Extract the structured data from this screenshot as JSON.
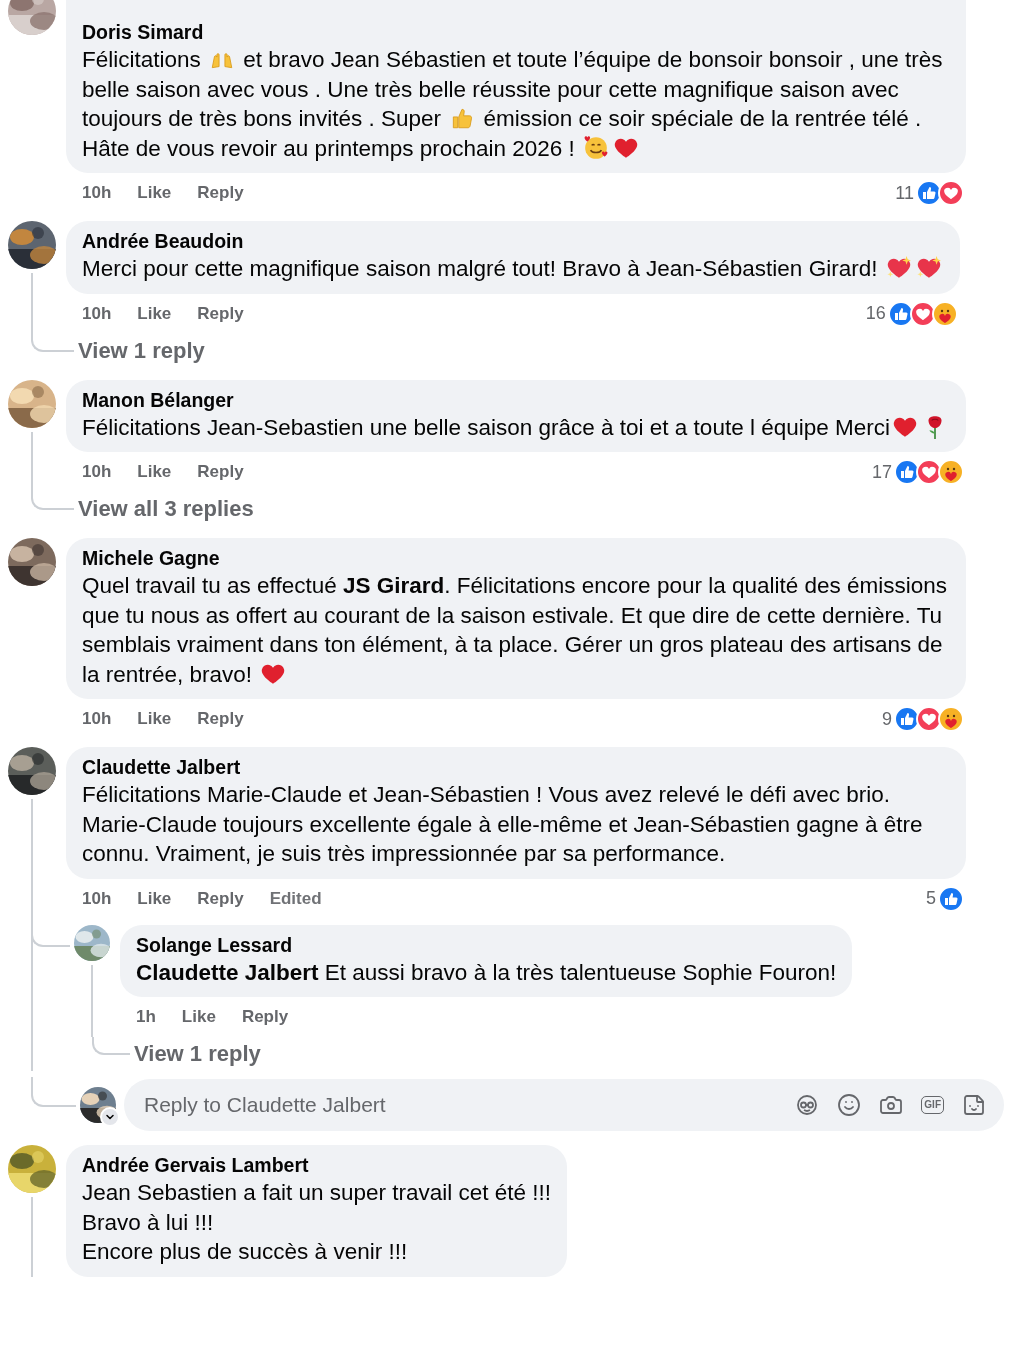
{
  "comments": [
    {
      "author": "Doris Simard",
      "body": [
        {
          "kind": "text",
          "text": "Félicitations "
        },
        {
          "kind": "clap"
        },
        {
          "kind": "text",
          "text": " et bravo Jean Sébastien et toute l’équipe de bonsoir bonsoir , une très belle saison avec vous . Une très belle réussite pour cette magnifique saison avec toujours de très bons invités . Super "
        },
        {
          "kind": "thumb"
        },
        {
          "kind": "text",
          "text": " émission ce soir spéciale de la rentrée télé . Hâte de vous revoir au printemps prochain 2026 ! "
        },
        {
          "kind": "adore"
        },
        {
          "kind": "heart"
        }
      ],
      "time": "10h",
      "actions": [
        {
          "kind": "link",
          "label": "Like"
        },
        {
          "kind": "link",
          "label": "Reply"
        }
      ],
      "reaction_count": "11",
      "reactions": [
        {
          "kind": "like"
        },
        {
          "kind": "love"
        }
      ]
    },
    {
      "author": "Andrée Beaudoin",
      "body": [
        {
          "kind": "text",
          "text": "Merci pour cette magnifique saison malgré tout! Bravo à Jean-Sébastien Girard! "
        },
        {
          "kind": "sparkle"
        },
        {
          "kind": "sparkle"
        }
      ],
      "time": "10h",
      "actions": [
        {
          "kind": "link",
          "label": "Like"
        },
        {
          "kind": "link",
          "label": "Reply"
        }
      ],
      "reaction_count": "16",
      "reactions": [
        {
          "kind": "like"
        },
        {
          "kind": "love"
        },
        {
          "kind": "care"
        }
      ],
      "replies_link": "View 1 reply"
    },
    {
      "author": "Manon Bélanger",
      "body": [
        {
          "kind": "text",
          "text": "Félicitations Jean-Sebastien une belle saison grâce à toi et a toute l équipe Merci"
        },
        {
          "kind": "heart"
        },
        {
          "kind": "rose"
        }
      ],
      "time": "10h",
      "actions": [
        {
          "kind": "link",
          "label": "Like"
        },
        {
          "kind": "link",
          "label": "Reply"
        }
      ],
      "reaction_count": "17",
      "reactions": [
        {
          "kind": "like"
        },
        {
          "kind": "love"
        },
        {
          "kind": "care"
        }
      ],
      "replies_link": "View all 3 replies"
    },
    {
      "author": "Michele Gagne",
      "body": [
        {
          "kind": "text",
          "text": "Quel travail tu as effectué **JS Girard**. Félicitations encore pour la qualité des émissions que tu nous as offert au courant de la saison estivale. Et que dire de cette dernière. Tu semblais vraiment dans ton élément, à ta place. Gérer un gros plateau des artisans de la rentrée, bravo! "
        },
        {
          "kind": "heart"
        }
      ],
      "time": "10h",
      "actions": [
        {
          "kind": "link",
          "label": "Like"
        },
        {
          "kind": "link",
          "label": "Reply"
        }
      ],
      "reaction_count": "9",
      "reactions": [
        {
          "kind": "like"
        },
        {
          "kind": "love"
        },
        {
          "kind": "care"
        }
      ]
    },
    {
      "author": "Claudette Jalbert",
      "body": [
        {
          "kind": "text",
          "text": "Félicitations Marie-Claude et Jean-Sébastien ! Vous avez relevé le défi avec brio. Marie-Claude toujours excellente égale à elle-même et Jean-Sébastien gagne à être connu. Vraiment, je suis très impressionnée par sa performance."
        }
      ],
      "time": "10h",
      "actions": [
        {
          "kind": "link",
          "label": "Like"
        },
        {
          "kind": "link",
          "label": "Reply"
        },
        {
          "kind": "note",
          "label": "Edited"
        }
      ],
      "reaction_count": "5",
      "reactions": [
        {
          "kind": "like"
        }
      ],
      "replies": [
        {
          "author": "Solange Lessard",
          "body": [
            {
              "kind": "text",
              "text": "**Claudette Jalbert** Et aussi bravo à la très talentueuse Sophie Fouron!"
            }
          ],
          "time": "1h",
          "actions": [
            {
              "kind": "link",
              "label": "Like"
            },
            {
              "kind": "link",
              "label": "Reply"
            }
          ],
          "replies_link": "View 1 reply"
        }
      ],
      "reply_field": {
        "placeholder": "Reply to Claudette Jalbert",
        "gif_label": "GIF"
      }
    },
    {
      "author": "Andrée Gervais Lambert",
      "body": [
        {
          "kind": "text",
          "text": "Jean Sebastien a fait un super travail cet été !!!\nBravo à lui !!!\nEncore plus de succès à venir !!!"
        }
      ],
      "has_thread": true
    }
  ]
}
